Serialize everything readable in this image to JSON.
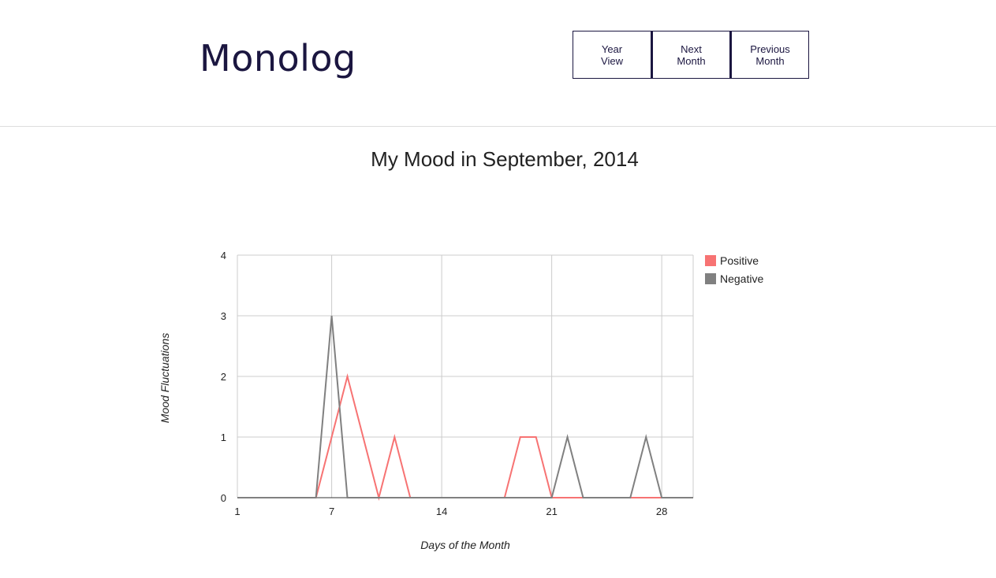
{
  "app": {
    "brand": "Monolog"
  },
  "nav": {
    "year_view_line1": "Year",
    "year_view_line2": "View",
    "next_month_line1": "Next",
    "next_month_line2": "Month",
    "previous_month_line1": "Previous",
    "previous_month_line2": "Month"
  },
  "colors": {
    "brand": "#1b1640",
    "positive": "#f77373",
    "negative": "#808080",
    "grid": "#cccccc"
  },
  "chart_data": {
    "type": "line",
    "title": "My Mood in September, 2014",
    "xlabel": "Days of the Month",
    "ylabel": "Mood Fluctuations",
    "xlim": [
      1,
      30
    ],
    "ylim": [
      0,
      4
    ],
    "x_ticks": [
      "1",
      "7",
      "14",
      "21",
      "28"
    ],
    "y_ticks": [
      "0",
      "1",
      "2",
      "3",
      "4"
    ],
    "grid": true,
    "legend_position": "right",
    "x": [
      1,
      2,
      3,
      4,
      5,
      6,
      7,
      8,
      9,
      10,
      11,
      12,
      13,
      14,
      15,
      16,
      17,
      18,
      19,
      20,
      21,
      22,
      23,
      24,
      25,
      26,
      27,
      28,
      29,
      30
    ],
    "series": [
      {
        "name": "Positive",
        "color": "#f77373",
        "values": [
          0,
          0,
          0,
          0,
          0,
          0,
          1,
          2,
          1,
          0,
          1,
          0,
          0,
          0,
          0,
          0,
          0,
          0,
          1,
          1,
          0,
          0,
          0,
          0,
          0,
          0,
          0,
          0,
          0,
          0
        ]
      },
      {
        "name": "Negative",
        "color": "#808080",
        "values": [
          0,
          0,
          0,
          0,
          0,
          0,
          3,
          0,
          0,
          0,
          0,
          0,
          0,
          0,
          0,
          0,
          0,
          0,
          0,
          0,
          0,
          1,
          0,
          0,
          0,
          0,
          1,
          0,
          0,
          0
        ]
      }
    ]
  }
}
